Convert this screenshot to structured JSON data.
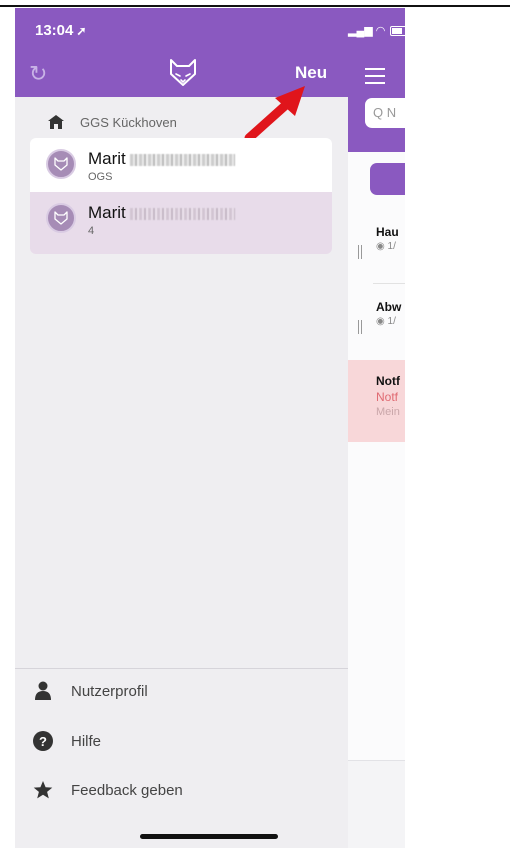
{
  "status_bar": {
    "time": "13:04",
    "location_glyph": "➚"
  },
  "drawer": {
    "refresh_icon": "refresh-icon",
    "logo_icon": "fox-logo-icon",
    "new_label": "Neu",
    "school_name": "GGS Kückhoven",
    "contacts": [
      {
        "name": "Marit",
        "subtitle": "OGS",
        "selected": false
      },
      {
        "name": "Marit",
        "subtitle": "4",
        "selected": true
      }
    ],
    "menu": [
      {
        "label": "Nutzerprofil",
        "icon": "user-icon"
      },
      {
        "label": "Hilfe",
        "icon": "help-icon"
      },
      {
        "label": "Feedback geben",
        "icon": "star-icon"
      }
    ]
  },
  "main": {
    "search_placeholder": "Q N",
    "messages": [
      {
        "title": "Hau",
        "meta": "◉ 1/"
      },
      {
        "title": "Abw",
        "meta": "◉ 1/"
      }
    ],
    "alert": {
      "title": "Notf",
      "line2": "Notf",
      "line3": "Mein"
    }
  },
  "colors": {
    "brand": "#8a59c0",
    "alert_bg": "#f8d7d9",
    "annotation_arrow": "#e0151b"
  }
}
